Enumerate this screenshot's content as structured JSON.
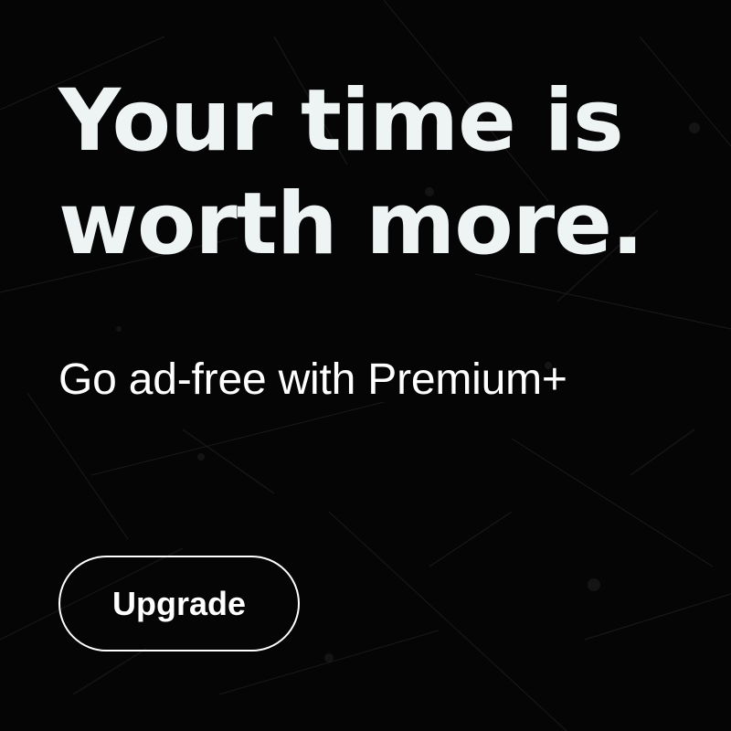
{
  "ad": {
    "headline_line1": "Your time is",
    "headline_line2": "worth more.",
    "subhead": "Go ad-free with Premium+",
    "cta_label": "Upgrade"
  },
  "colors": {
    "background": "#050505",
    "headline": "#eef3f4",
    "text": "#ffffff",
    "button_border": "#ffffff"
  }
}
